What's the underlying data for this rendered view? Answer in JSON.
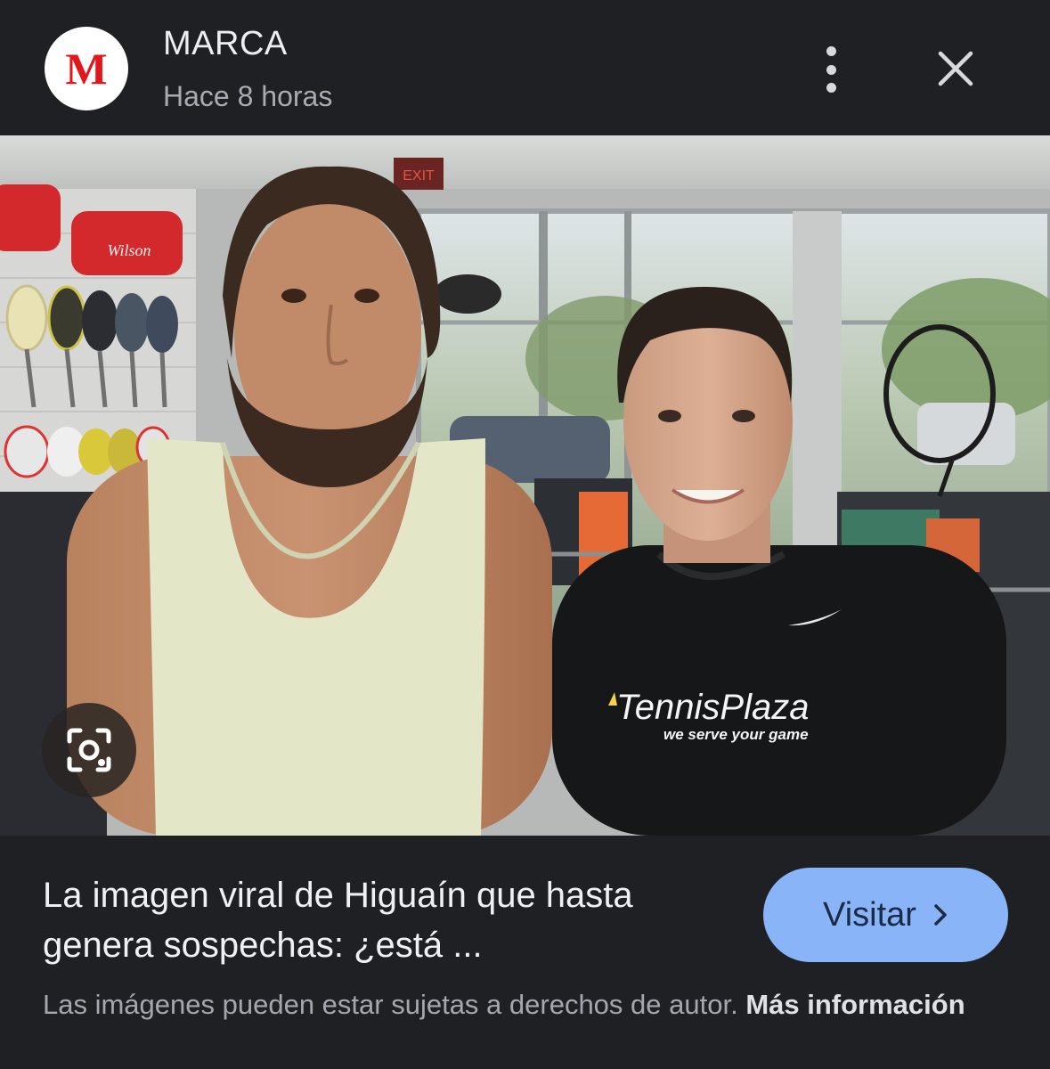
{
  "header": {
    "logo_letter": "M",
    "source": "MARCA",
    "time": "Hace 8 horas",
    "menu_icon": "more-vert-icon",
    "close_icon": "close-icon"
  },
  "photo": {
    "shirt_brand": "TennisPlaza",
    "shirt_tagline": "we serve your game",
    "rack_brand": "Wilson",
    "exit_sign": "EXIT",
    "lens_icon": "google-lens-icon"
  },
  "result": {
    "title": "La imagen viral de Higuaín que hasta genera sospechas: ¿está ...",
    "visit_label": "Visitar",
    "visit_icon": "chevron-right-icon"
  },
  "footer": {
    "copyright_text": "Las imágenes pueden estar sujetas a derechos de autor.",
    "more_info_link": "Más información"
  },
  "colors": {
    "background": "#1f2024",
    "accent_button": "#8ab4f8",
    "logo_red": "#e2161b"
  }
}
